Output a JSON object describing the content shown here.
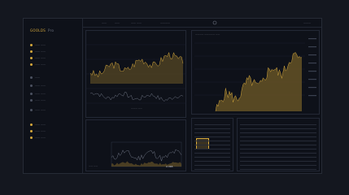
{
  "brand": {
    "name": "GOOLDS",
    "tag": "Pro"
  },
  "sidebar": {
    "items": [
      {
        "label": "—— ——",
        "icon": "gold-dot-icon"
      },
      {
        "label": "—— ——",
        "icon": "gold-dot-icon"
      },
      {
        "label": "—— ——",
        "icon": "gold-dot-icon"
      },
      {
        "label": "—— ——",
        "icon": "gold-dot-icon"
      },
      {
        "label": "——",
        "icon": "grey-dot-icon"
      },
      {
        "label": "—— ——",
        "icon": "grey-dot-icon"
      },
      {
        "label": "—— ——",
        "icon": "grey-dot-icon"
      },
      {
        "label": "—— ——",
        "icon": "grey-dot-icon"
      },
      {
        "label": "—— ——",
        "icon": "grey-dot-icon"
      },
      {
        "label": "—— ——",
        "icon": "gold-dot-icon"
      },
      {
        "label": "—— ——",
        "icon": "gold-dot-icon"
      },
      {
        "label": "—— ——",
        "icon": "gold-dot-icon"
      }
    ]
  },
  "topbar": {
    "items": [
      "——",
      "——",
      "—— ——",
      "————",
      "———"
    ]
  },
  "panels": {
    "main_chart_label": "——— ——",
    "small_chart_label": "—— ——",
    "right_chart_title": "———— ————— ——",
    "footer_value": "2,365"
  },
  "colors": {
    "accent": "#d4a73c",
    "panel": "#0e1119",
    "line": "#6b7180"
  }
}
